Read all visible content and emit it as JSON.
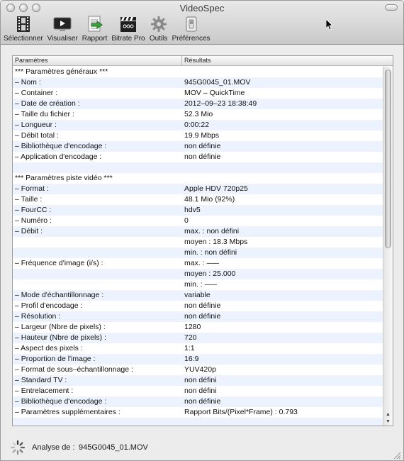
{
  "window": {
    "title": "VideoSpec"
  },
  "toolbar": {
    "items": [
      {
        "label": "Sélectionner",
        "icon": "film-strip-icon"
      },
      {
        "label": "Visualiser",
        "icon": "play-monitor-icon"
      },
      {
        "label": "Rapport",
        "icon": "report-export-icon"
      },
      {
        "label": "Bitrate Pro",
        "icon": "clapperboard-icon"
      },
      {
        "label": "Outils",
        "icon": "gear-icon"
      },
      {
        "label": "Préférences",
        "icon": "switch-icon"
      }
    ]
  },
  "table": {
    "headers": {
      "params": "Paramètres",
      "results": "Résultats"
    },
    "rows": [
      {
        "k": "*** Paramètres généraux ***",
        "v": ""
      },
      {
        "k": "– Nom :",
        "v": "945G0045_01.MOV"
      },
      {
        "k": "– Container :",
        "v": "MOV – QuickTime"
      },
      {
        "k": "– Date de création :",
        "v": "2012–09–23 18:38:49"
      },
      {
        "k": "– Taille du fichier :",
        "v": "52.3 Mio"
      },
      {
        "k": "– Longueur :",
        "v": "0:00:22"
      },
      {
        "k": "– Débit total :",
        "v": "19.9 Mbps"
      },
      {
        "k": "– Bibliothèque d'encodage :",
        "v": "non définie"
      },
      {
        "k": "– Application d'encodage :",
        "v": "non définie"
      },
      {
        "k": "",
        "v": ""
      },
      {
        "k": "*** Paramètres piste vidéo ***",
        "v": ""
      },
      {
        "k": "– Format :",
        "v": "Apple HDV 720p25"
      },
      {
        "k": "– Taille :",
        "v": "48.1 Mio (92%)"
      },
      {
        "k": "– FourCC :",
        "v": "hdv5"
      },
      {
        "k": "– Numéro :",
        "v": "0"
      },
      {
        "k": "– Débit :",
        "v": "max. : non défini"
      },
      {
        "k": "",
        "v": "moyen : 18.3 Mbps"
      },
      {
        "k": "",
        "v": "min. : non défini"
      },
      {
        "k": "– Fréquence d'image (i/s) :",
        "v": "max. : –––"
      },
      {
        "k": "",
        "v": "moyen : 25.000"
      },
      {
        "k": "",
        "v": "min. : –––"
      },
      {
        "k": "– Mode d'échantillonnage :",
        "v": "variable"
      },
      {
        "k": "– Profil d'encodage :",
        "v": "non définie"
      },
      {
        "k": "– Résolution :",
        "v": "non définie"
      },
      {
        "k": "– Largeur (Nbre de pixels) :",
        "v": "1280"
      },
      {
        "k": "– Hauteur (Nbre de pixels) :",
        "v": "720"
      },
      {
        "k": "– Aspect des pixels :",
        "v": "1:1"
      },
      {
        "k": "– Proportion de l'image :",
        "v": "16:9"
      },
      {
        "k": "– Format de sous–échantillonnage :",
        "v": "YUV420p"
      },
      {
        "k": "– Standard TV :",
        "v": "non défini"
      },
      {
        "k": "– Entrelacement :",
        "v": "non défini"
      },
      {
        "k": "– Bibliothèque d'encodage :",
        "v": "non définie"
      },
      {
        "k": "– Paramètres supplémentaires :",
        "v": "Rapport Bits/(Pixel*Frame) : 0.793"
      },
      {
        "k": "",
        "v": ""
      }
    ]
  },
  "status": {
    "label": "Analyse de :",
    "file": "945G0045_01.MOV"
  }
}
